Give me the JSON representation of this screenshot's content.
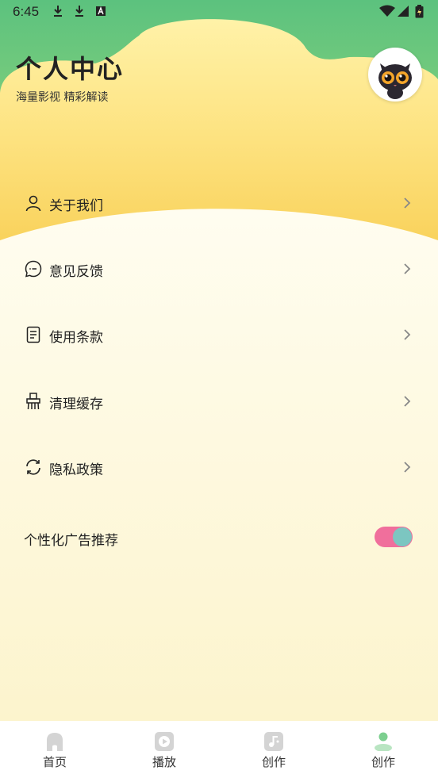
{
  "status_bar": {
    "time": "6:45"
  },
  "header": {
    "title": "个人中心",
    "subtitle": "海量影视 精彩解读"
  },
  "menu": [
    {
      "label": "关于我们",
      "icon": "person-icon"
    },
    {
      "label": "意见反馈",
      "icon": "chat-bubble-icon"
    },
    {
      "label": "使用条款",
      "icon": "document-icon"
    },
    {
      "label": "清理缓存",
      "icon": "broom-icon"
    },
    {
      "label": "隐私政策",
      "icon": "refresh-icon"
    }
  ],
  "personalized_ads": {
    "label": "个性化广告推荐",
    "enabled": true
  },
  "tabs": [
    {
      "label": "首页",
      "icon": "home-icon",
      "active": false
    },
    {
      "label": "播放",
      "icon": "play-icon",
      "active": false
    },
    {
      "label": "创作",
      "icon": "music-note-icon",
      "active": false
    },
    {
      "label": "创作",
      "icon": "user-icon",
      "active": true
    }
  ],
  "colors": {
    "header_green": "#6cc77a",
    "header_yellow": "#fbd862",
    "background": "#fdf7dc",
    "toggle_track": "#f06f9c",
    "toggle_knob": "#7cc6c1",
    "tab_active": "#7ccf8f"
  }
}
